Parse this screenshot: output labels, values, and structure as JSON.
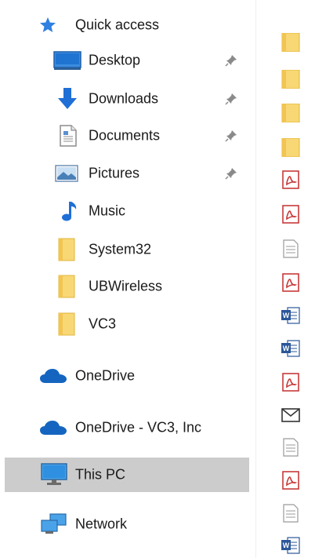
{
  "nav": {
    "quick_access": "Quick access",
    "items": [
      {
        "label": "Desktop",
        "icon": "desktop-icon",
        "pinned": true
      },
      {
        "label": "Downloads",
        "icon": "downloads-icon",
        "pinned": true
      },
      {
        "label": "Documents",
        "icon": "documents-icon",
        "pinned": true
      },
      {
        "label": "Pictures",
        "icon": "pictures-icon",
        "pinned": true
      },
      {
        "label": "Music",
        "icon": "music-icon",
        "pinned": false
      },
      {
        "label": "System32",
        "icon": "folder-icon",
        "pinned": false
      },
      {
        "label": "UBWireless",
        "icon": "folder-icon",
        "pinned": false
      },
      {
        "label": "VC3",
        "icon": "folder-icon",
        "pinned": false
      }
    ],
    "onedrive": "OneDrive",
    "onedrive_org": "OneDrive - VC3, Inc",
    "this_pc": "This PC",
    "network": "Network"
  },
  "colors": {
    "selected_bg": "#cccccc",
    "folder": "#f8d775",
    "accent_blue": "#1e70d8",
    "pdf_red": "#c83a3a",
    "word_blue": "#2b579a"
  },
  "file_list": {
    "types": [
      "folder",
      "folder",
      "folder",
      "folder",
      "pdf",
      "pdf",
      "text",
      "pdf",
      "word",
      "word",
      "pdf",
      "mail",
      "text",
      "pdf",
      "text",
      "word"
    ]
  }
}
